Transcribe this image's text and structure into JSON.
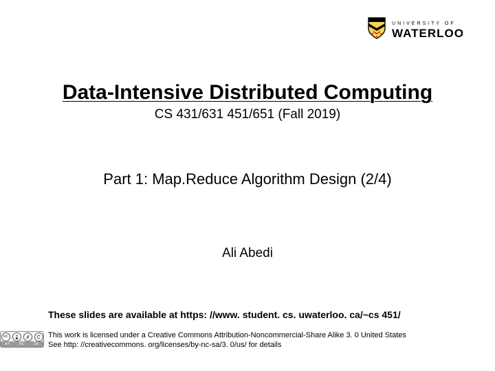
{
  "logo": {
    "university_of": "UNIVERSITY OF",
    "name": "WATERLOO"
  },
  "title": {
    "main": "Data-Intensive Distributed Computing",
    "course": "CS 431/631 451/651 (Fall 2019)"
  },
  "part": "Part 1: Map.Reduce Algorithm Design (2/4)",
  "author": "Ali Abedi",
  "availability": "These slides are available at https: //www. student. cs. uwaterloo. ca/~cs 451/",
  "license": {
    "line1": "This work is licensed under a Creative Commons Attribution-Noncommercial-Share Alike 3. 0 United States",
    "line2": "See http: //creativecommons. org/licenses/by-nc-sa/3. 0/us/ for details"
  },
  "cc_badge": {
    "cc": "cc",
    "by": "BY",
    "nc": "NC",
    "sa": "SA"
  }
}
